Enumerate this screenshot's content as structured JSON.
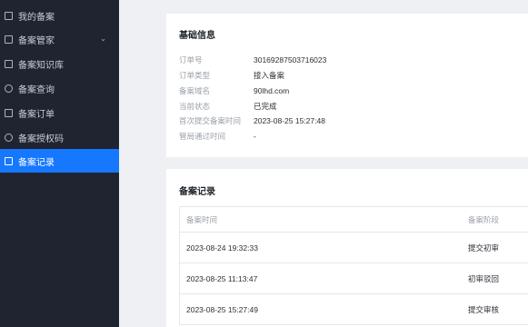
{
  "sidebar": {
    "items": [
      {
        "label": "我的备案",
        "icon": "square-icon"
      },
      {
        "label": "备案管家",
        "icon": "info-square-icon",
        "caret": "⌄"
      },
      {
        "label": "备案知识库",
        "icon": "book-icon"
      },
      {
        "label": "备案查询",
        "icon": "search-icon"
      },
      {
        "label": "备案订单",
        "icon": "checkbox-icon"
      },
      {
        "label": "备案授权码",
        "icon": "info-circle-icon"
      },
      {
        "label": "备案记录",
        "icon": "document-icon",
        "active": true
      }
    ]
  },
  "basic_info": {
    "title": "基础信息",
    "rows": [
      {
        "label": "订单号",
        "value": "30169287503716023"
      },
      {
        "label": "订单类型",
        "value": "接入备案"
      },
      {
        "label": "备案域名",
        "value": "90lhd.com"
      },
      {
        "label": "当前状态",
        "value": "已完成"
      },
      {
        "label": "首次提交备案时间",
        "value": "2023-08-25 15:27:48"
      },
      {
        "label": "管局通过时间",
        "value": "-"
      }
    ]
  },
  "records": {
    "title": "备案记录",
    "columns": [
      "备案时间",
      "备案阶段"
    ],
    "rows": [
      {
        "time": "2023-08-24 19:32:33",
        "stage": "提交初审"
      },
      {
        "time": "2023-08-25 11:13:47",
        "stage": "初审驳回"
      },
      {
        "time": "2023-08-25 15:27:49",
        "stage": "提交审核"
      }
    ]
  },
  "colors": {
    "sidebar_bg": "#1f2430",
    "accent": "#1677ff",
    "page_bg": "#eef0f4"
  }
}
